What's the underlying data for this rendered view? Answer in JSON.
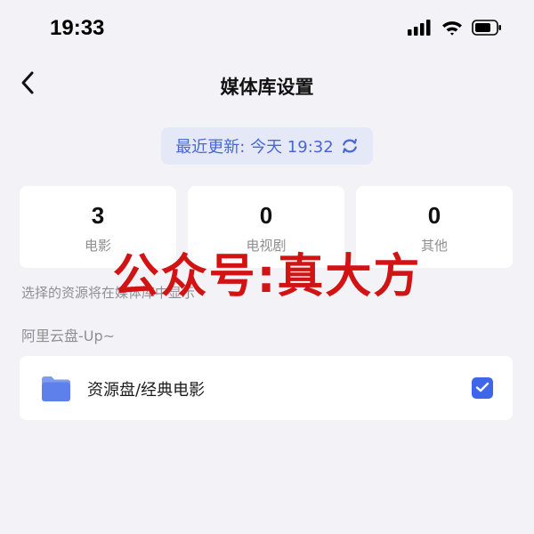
{
  "status_bar": {
    "time": "19:33",
    "icons": [
      "cellular-signal-icon",
      "wifi-icon",
      "battery-icon"
    ]
  },
  "header": {
    "title": "媒体库设置",
    "back_icon": "chevron-left-icon"
  },
  "update": {
    "text": "最近更新: 今天 19:32",
    "icon": "refresh-icon",
    "accent": "#4767d4"
  },
  "stats": [
    {
      "value": "3",
      "label": "电影"
    },
    {
      "value": "0",
      "label": "电视剧"
    },
    {
      "value": "0",
      "label": "其他"
    }
  ],
  "hint": "选择的资源将在媒体库中显示",
  "section": {
    "title": "阿里云盘-Up~"
  },
  "folders": [
    {
      "label": "资源盘/经典电影",
      "checked": true,
      "icon": "folder-icon"
    }
  ],
  "watermark": "公众号:真大方",
  "colors": {
    "background": "#f2f2f7",
    "card": "#ffffff",
    "checkbox": "#3f66e8",
    "watermark": "#d21313"
  }
}
